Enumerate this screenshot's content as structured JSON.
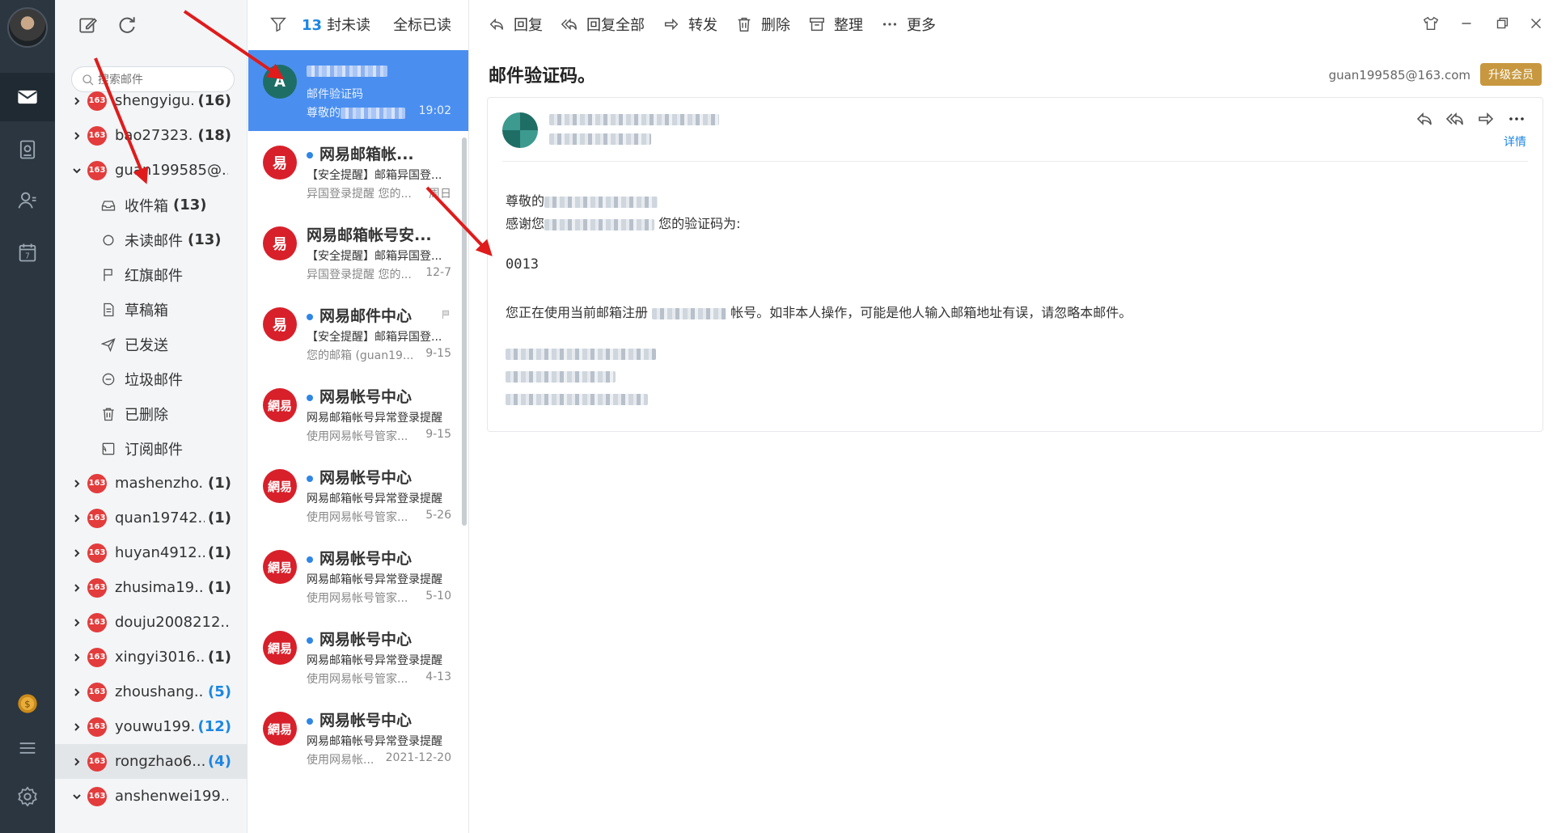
{
  "folders": {
    "search_placeholder": "搜索邮件",
    "accounts_top": [
      {
        "name": "shengyigu...",
        "count": "(16)",
        "blue": false
      },
      {
        "name": "bao27323...",
        "count": "(18)",
        "blue": false
      }
    ],
    "current_account": {
      "name": "guan199585@...",
      "count": ""
    },
    "subfolders": [
      {
        "label": "收件箱",
        "count": "(13)",
        "icon": "inbox-icon"
      },
      {
        "label": "未读邮件",
        "count": "(13)",
        "icon": "unread-circle-icon"
      },
      {
        "label": "红旗邮件",
        "count": "",
        "icon": "flag-icon"
      },
      {
        "label": "草稿箱",
        "count": "",
        "icon": "draft-icon"
      },
      {
        "label": "已发送",
        "count": "",
        "icon": "sent-icon"
      },
      {
        "label": "垃圾邮件",
        "count": "",
        "icon": "spam-icon"
      },
      {
        "label": "已删除",
        "count": "",
        "icon": "trash-icon"
      },
      {
        "label": "订阅邮件",
        "count": "",
        "icon": "subscription-icon"
      }
    ],
    "accounts_bottom": [
      {
        "name": "mashenzho...",
        "count": "(1)",
        "blue": false
      },
      {
        "name": "quan19742...",
        "count": "(1)",
        "blue": false
      },
      {
        "name": "huyan4912...",
        "count": "(1)",
        "blue": false
      },
      {
        "name": "zhusima19...",
        "count": "(1)",
        "blue": false
      },
      {
        "name": "douju2008212...",
        "count": "",
        "blue": false
      },
      {
        "name": "xingyi3016...",
        "count": "(1)",
        "blue": false
      },
      {
        "name": "zhoushang...",
        "count": "(5)",
        "blue": true
      },
      {
        "name": "youwu199...",
        "count": "(12)",
        "blue": true
      },
      {
        "name": "rongzhao6...",
        "count": "(4)",
        "blue": true
      },
      {
        "name": "anshenwei199...",
        "count": "",
        "blue": false
      }
    ],
    "badge_text": "163"
  },
  "list": {
    "unread_count": "13",
    "unread_label": "封未读",
    "mark_all_read": "全标已读",
    "mails": [
      {
        "sender": "",
        "subject": "邮件验证码",
        "preview": "尊敬的",
        "date": "19:02",
        "avatar": "A",
        "avatar_color": "#1f6e66",
        "unread": false,
        "selected": true
      },
      {
        "sender": "网易邮箱帐...",
        "subject": "【安全提醒】邮箱异国登...",
        "preview": "异国登录提醒 您的...",
        "date": "周日",
        "avatar": "易",
        "avatar_color": "#d8202a",
        "unread": true,
        "selected": false
      },
      {
        "sender": "网易邮箱帐号安...",
        "subject": "【安全提醒】邮箱异国登...",
        "preview": "异国登录提醒 您的...",
        "date": "12-7",
        "avatar": "易",
        "avatar_color": "#d8202a",
        "unread": false,
        "selected": false
      },
      {
        "sender": "网易邮件中心",
        "subject": "【安全提醒】邮箱异国登...",
        "preview": "您的邮箱 (guan19...",
        "date": "9-15",
        "avatar": "易",
        "avatar_color": "#d8202a",
        "unread": true,
        "selected": false
      },
      {
        "sender": "网易帐号中心",
        "subject": "网易邮箱帐号异常登录提醒",
        "preview": "使用网易帐号管家...",
        "date": "9-15",
        "avatar": "網易",
        "avatar_color": "#d8202a",
        "unread": true,
        "selected": false
      },
      {
        "sender": "网易帐号中心",
        "subject": "网易邮箱帐号异常登录提醒",
        "preview": "使用网易帐号管家...",
        "date": "5-26",
        "avatar": "網易",
        "avatar_color": "#d8202a",
        "unread": true,
        "selected": false
      },
      {
        "sender": "网易帐号中心",
        "subject": "网易邮箱帐号异常登录提醒",
        "preview": "使用网易帐号管家...",
        "date": "5-10",
        "avatar": "網易",
        "avatar_color": "#d8202a",
        "unread": true,
        "selected": false
      },
      {
        "sender": "网易帐号中心",
        "subject": "网易邮箱帐号异常登录提醒",
        "preview": "使用网易帐号管家...",
        "date": "4-13",
        "avatar": "網易",
        "avatar_color": "#d8202a",
        "unread": true,
        "selected": false
      },
      {
        "sender": "网易帐号中心",
        "subject": "网易邮箱帐号异常登录提醒",
        "preview": "使用网易帐...",
        "date": "2021-12-20",
        "avatar": "網易",
        "avatar_color": "#d8202a",
        "unread": true,
        "selected": false
      }
    ]
  },
  "toolbar": {
    "reply": "回复",
    "reply_all": "回复全部",
    "forward": "转发",
    "delete": "删除",
    "organize": "整理",
    "more": "更多"
  },
  "reader": {
    "title": "邮件验证码。",
    "account_email": "guan199585@163.com",
    "upgrade": "升级会员",
    "detail": "详情",
    "greeting": "尊敬的",
    "thanks_prefix": "感谢您",
    "thanks_suffix": "您的验证码为:",
    "code": "0013",
    "notice_prefix": "您正在使用当前邮箱注册",
    "notice_suffix": "帐号。如非本人操作，可能是他人输入邮箱地址有误，请忽略本邮件。"
  }
}
